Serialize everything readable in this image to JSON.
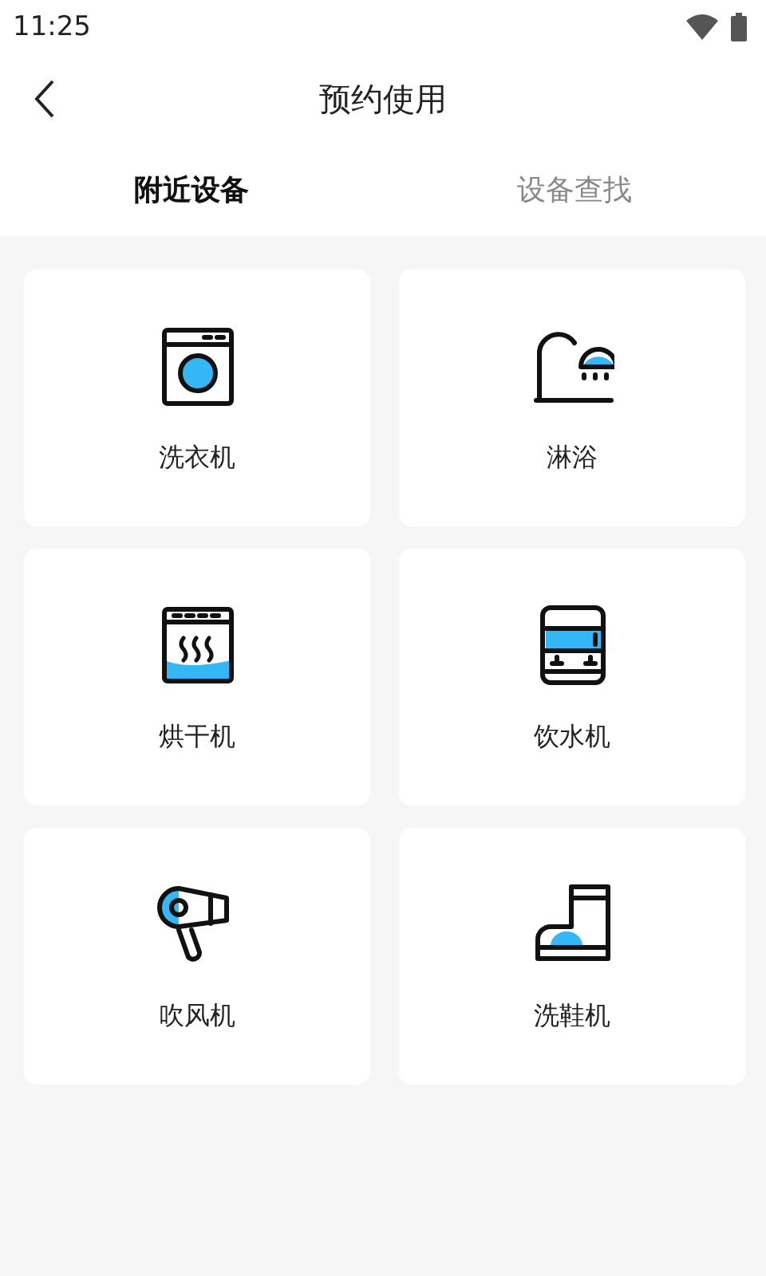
{
  "status_bar": {
    "time": "11:25"
  },
  "header": {
    "title": "预约使用"
  },
  "tabs": [
    {
      "label": "附近设备",
      "selected": true
    },
    {
      "label": "设备查找",
      "selected": false
    }
  ],
  "devices": [
    {
      "kind": "washer",
      "label": "洗衣机"
    },
    {
      "kind": "shower",
      "label": "淋浴"
    },
    {
      "kind": "dryer",
      "label": "烘干机"
    },
    {
      "kind": "water",
      "label": "饮水机"
    },
    {
      "kind": "hairdryer",
      "label": "吹风机"
    },
    {
      "kind": "shoe",
      "label": "洗鞋机"
    }
  ]
}
